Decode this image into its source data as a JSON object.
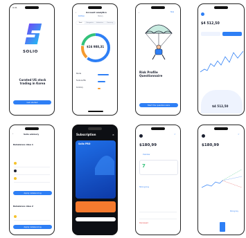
{
  "status": {
    "time": "9:41"
  },
  "welcome": {
    "brand": "SOLIO",
    "tagline": "",
    "headline": "Curated US stock trading in Korea",
    "description": "",
    "cta": "Get started"
  },
  "analytics": {
    "title": "Account analytics",
    "segments": [
      "Portfolio",
      "History"
    ],
    "tabs": [
      "Total",
      "Categories",
      "Industries",
      "Currency"
    ],
    "total": "$16 988,31",
    "rows": [
      {
        "label": "Stocks",
        "value": ""
      },
      {
        "label": "Funds & Etfs",
        "value": ""
      },
      {
        "label": "Currency",
        "value": ""
      }
    ]
  },
  "risk": {
    "skip": "Skip",
    "title": "Risk Profile Questionnaire",
    "description": "",
    "cta": "Start the questionnaire"
  },
  "portfolio": {
    "name": "",
    "value": "$4 512,50",
    "ranges": [
      "",
      "",
      "",
      "",
      ""
    ],
    "summary": "$4 512,50"
  },
  "advisory": {
    "title": "Solio advisory",
    "cta": "Apply rebalancing",
    "items": [
      {
        "title": "Rebalance idea 1",
        "description": "",
        "holdings": [
          {
            "name": "",
            "value": ""
          },
          {
            "name": "",
            "value": ""
          },
          {
            "name": "",
            "value": ""
          }
        ]
      },
      {
        "title": "Rebalance idea 2",
        "description": "",
        "holdings": [
          {
            "name": "",
            "value": ""
          }
        ]
      }
    ]
  },
  "subscription": {
    "title": "Subscription",
    "plan": "Solio PRO",
    "price": "",
    "features": [
      "",
      "",
      "",
      ""
    ],
    "promo": "",
    "cta": "",
    "terms": ""
  },
  "stock_a": {
    "ticker": "",
    "price": "$180,99",
    "tabs": [
      "Overview",
      ""
    ],
    "score": "7",
    "overview_title": "",
    "overview_text": "",
    "rating_label": "",
    "rating": "Strong buy",
    "metrics_label": "",
    "metrics": [
      {
        "name": "",
        "value": ""
      },
      {
        "name": "",
        "value": ""
      }
    ],
    "change": "Decreased"
  },
  "stock_b": {
    "ticker": "",
    "price": "$180,99",
    "tabs": [
      "",
      ""
    ],
    "target_title": "",
    "rating": "Strong buy"
  }
}
